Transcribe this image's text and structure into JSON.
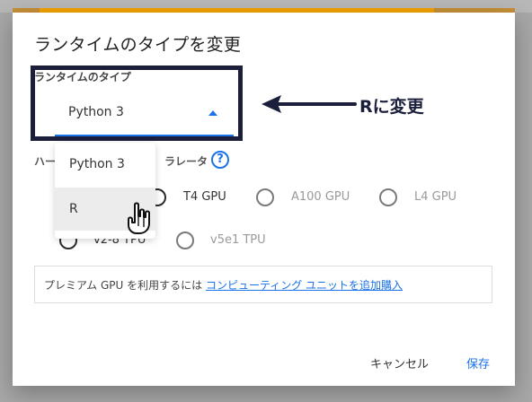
{
  "dialog": {
    "title": "ランタイムのタイプを変更",
    "runtime_type_label": "ランタイムのタイプ",
    "selected_runtime": "Python 3",
    "callout_text": "Rに変更",
    "hardware_label_left": "ハー",
    "hardware_label_right": "ラレータ",
    "help_icon_text": "?",
    "dropdown_options": [
      "Python 3",
      "R"
    ],
    "accelerators": [
      "T4 GPU",
      "A100 GPU",
      "L4 GPU",
      "v2-8 TPU",
      "v5e1 TPU"
    ],
    "info_prefix": "プレミアム GPU を利用するには ",
    "info_link": "コンピューティング ユニットを追加購入",
    "cancel_label": "キャンセル",
    "save_label": "保存"
  },
  "colors": {
    "accent": "#1a73e8",
    "callout": "#1b1f3b",
    "top_orange": "#f5a300",
    "top_orange_dark": "#c69039",
    "dialog_bg": "#ffffff",
    "page_overlay": "#a7a7a7"
  }
}
